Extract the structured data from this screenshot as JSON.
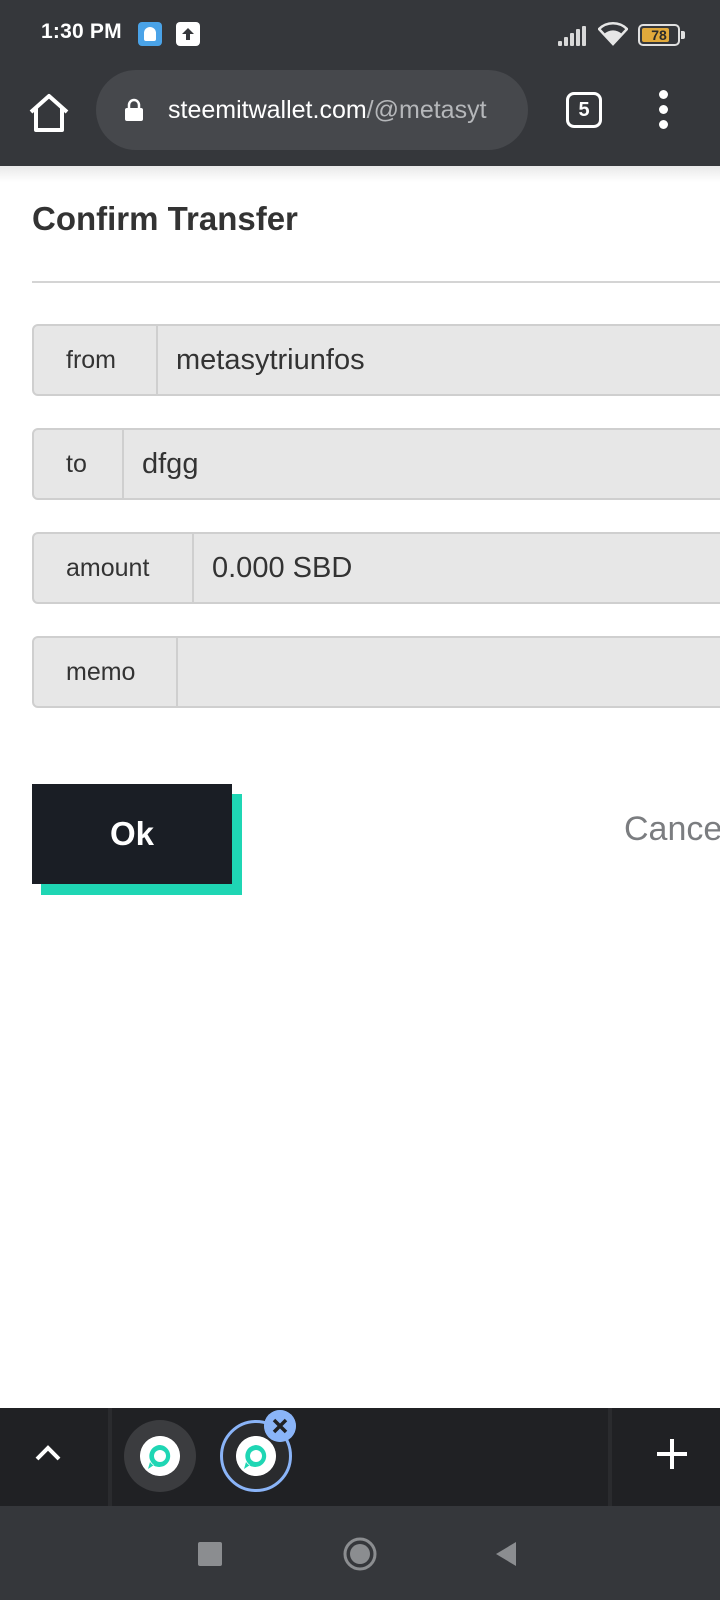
{
  "status_bar": {
    "time": "1:30 PM",
    "battery_level": "78",
    "battery_fraction": 0.78,
    "icons": [
      "notification-app-icon",
      "upload-icon",
      "signal-icon",
      "wifi-icon",
      "battery-icon"
    ]
  },
  "browser": {
    "url_host": "steemitwallet.com",
    "url_path": "/@metasyt",
    "tab_count": "5",
    "icons": [
      "home-icon",
      "lock-icon",
      "tab-switcher-icon",
      "more-vert-icon"
    ]
  },
  "dialog": {
    "title": "Confirm Transfer",
    "fields": [
      {
        "label": "from",
        "value": "metasytriunfos"
      },
      {
        "label": "to",
        "value": "dfgg"
      },
      {
        "label": "amount",
        "value": "0.000 SBD"
      },
      {
        "label": "memo",
        "value": ""
      }
    ],
    "ok_label": "Ok",
    "cancel_label": "Cance"
  },
  "tab_strip": {
    "icons": [
      "chevron-up-icon",
      "steemit-logo-icon",
      "close-icon",
      "plus-icon"
    ]
  },
  "colors": {
    "chrome_bg": "#35373b",
    "ok_button": "#1a1e25",
    "ok_shadow": "#1fd6b4",
    "tab_active_ring": "#8ab4f8"
  }
}
